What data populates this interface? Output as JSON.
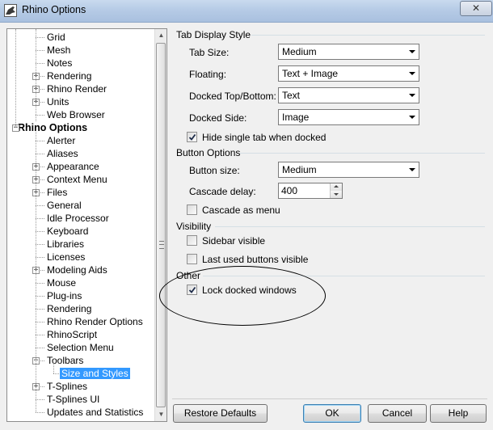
{
  "window": {
    "title": "Rhino Options",
    "close_glyph": "✕"
  },
  "tree": {
    "items": [
      {
        "label": "Grid",
        "level": 2,
        "expandable": false
      },
      {
        "label": "Mesh",
        "level": 2,
        "expandable": false
      },
      {
        "label": "Notes",
        "level": 2,
        "expandable": false
      },
      {
        "label": "Rendering",
        "level": 2,
        "expandable": true
      },
      {
        "label": "Rhino Render",
        "level": 2,
        "expandable": true
      },
      {
        "label": "Units",
        "level": 2,
        "expandable": true
      },
      {
        "label": "Web Browser",
        "level": 2,
        "expandable": false
      },
      {
        "label": "Rhino Options",
        "level": 1,
        "expandable": true,
        "expanded": true,
        "bold": true
      },
      {
        "label": "Alerter",
        "level": 2,
        "expandable": false
      },
      {
        "label": "Aliases",
        "level": 2,
        "expandable": false
      },
      {
        "label": "Appearance",
        "level": 2,
        "expandable": true
      },
      {
        "label": "Context Menu",
        "level": 2,
        "expandable": true
      },
      {
        "label": "Files",
        "level": 2,
        "expandable": true
      },
      {
        "label": "General",
        "level": 2,
        "expandable": false
      },
      {
        "label": "Idle Processor",
        "level": 2,
        "expandable": false
      },
      {
        "label": "Keyboard",
        "level": 2,
        "expandable": false
      },
      {
        "label": "Libraries",
        "level": 2,
        "expandable": false
      },
      {
        "label": "Licenses",
        "level": 2,
        "expandable": false
      },
      {
        "label": "Modeling Aids",
        "level": 2,
        "expandable": true
      },
      {
        "label": "Mouse",
        "level": 2,
        "expandable": false
      },
      {
        "label": "Plug-ins",
        "level": 2,
        "expandable": false
      },
      {
        "label": "Rendering",
        "level": 2,
        "expandable": false
      },
      {
        "label": "Rhino Render Options",
        "level": 2,
        "expandable": false
      },
      {
        "label": "RhinoScript",
        "level": 2,
        "expandable": false
      },
      {
        "label": "Selection Menu",
        "level": 2,
        "expandable": false
      },
      {
        "label": "Toolbars",
        "level": 2,
        "expandable": true,
        "expanded": true
      },
      {
        "label": "Size and Styles",
        "level": 3,
        "expandable": false,
        "selected": true
      },
      {
        "label": "T-Splines",
        "level": 2,
        "expandable": true
      },
      {
        "label": "T-Splines UI",
        "level": 2,
        "expandable": false
      },
      {
        "label": "Updates and Statistics",
        "level": 2,
        "expandable": false
      }
    ]
  },
  "tab_display": {
    "title": "Tab Display Style",
    "tab_size": {
      "label": "Tab Size:",
      "value": "Medium"
    },
    "floating": {
      "label": "Floating:",
      "value": "Text + Image"
    },
    "docked_top_bottom": {
      "label": "Docked Top/Bottom:",
      "value": "Text"
    },
    "docked_side": {
      "label": "Docked Side:",
      "value": "Image"
    },
    "hide_single_tab": {
      "label": "Hide single tab when docked",
      "checked": true
    }
  },
  "button_options": {
    "title": "Button Options",
    "button_size": {
      "label": "Button size:",
      "value": "Medium"
    },
    "cascade_delay": {
      "label": "Cascade delay:",
      "value": "400"
    },
    "cascade_as_menu": {
      "label": "Cascade as menu",
      "checked": false
    }
  },
  "visibility": {
    "title": "Visibility",
    "sidebar_visible": {
      "label": "Sidebar visible",
      "checked": false
    },
    "last_used_visible": {
      "label": "Last used buttons visible",
      "checked": false
    }
  },
  "other": {
    "title": "Other",
    "lock_docked_windows": {
      "label": "Lock docked windows",
      "checked": true
    }
  },
  "buttons": {
    "restore_defaults": "Restore Defaults",
    "ok": "OK",
    "cancel": "Cancel",
    "help": "Help"
  }
}
